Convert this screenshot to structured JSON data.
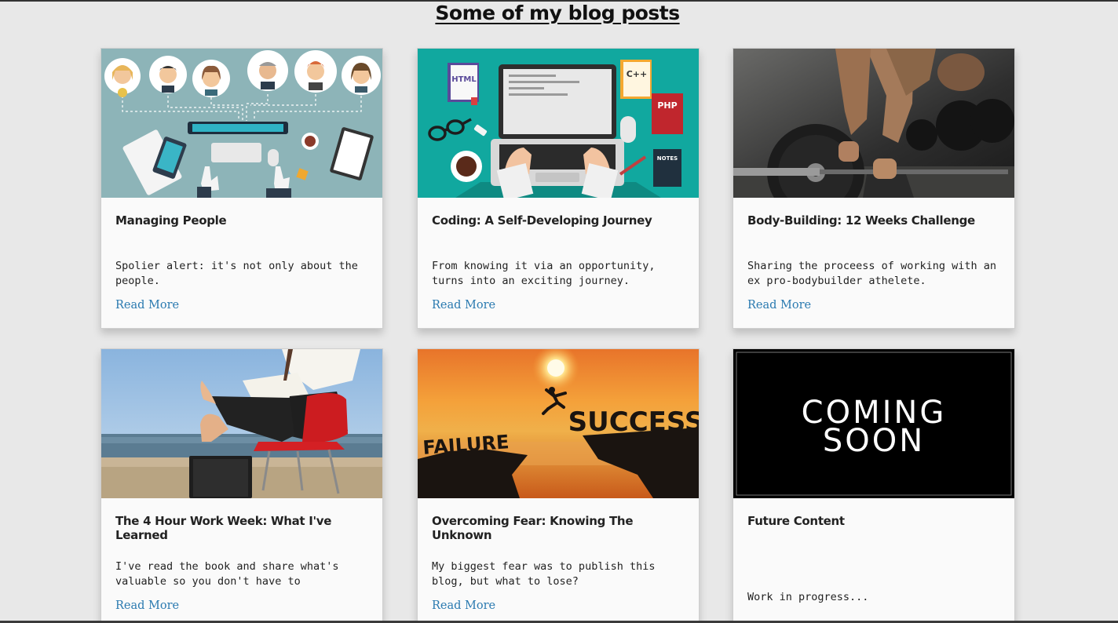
{
  "heading": "Some of my blog posts",
  "colors": {
    "link": "#2a7ab0",
    "card_bg": "#fafafa",
    "page_bg": "#e8e8e8"
  },
  "posts": [
    {
      "title": "Managing People",
      "excerpt": "Spolier alert: it's not only about the people.",
      "link": "Read More",
      "image": "team-management-illustration"
    },
    {
      "title": "Coding: A Self-Developing Journey",
      "excerpt": "From knowing it via an opportunity, turns into an exciting journey.",
      "link": "Read More",
      "image": "laptop-coding-illustration"
    },
    {
      "title": "Body-Building: 12 Weeks Challenge",
      "excerpt": "Sharing the proceess of working with an ex pro-bodybuilder athelete.",
      "link": "Read More",
      "image": "barbell-deadlift-photo"
    },
    {
      "title": "The 4 Hour Work Week: What I've Learned",
      "excerpt": "I've read the book and share what's valuable so you don't have to",
      "link": "Read More",
      "image": "beach-chair-laptop-photo"
    },
    {
      "title": "Overcoming Fear: Knowing The Unknown",
      "excerpt": "My biggest fear was to publish this blog, but what to lose?",
      "link": "Read More",
      "image": "failure-success-cliff-photo"
    },
    {
      "title": "Future Content",
      "excerpt": "Work in progress...",
      "image": "coming-soon-banner",
      "image_text_1": "COMING",
      "image_text_2": "SOON"
    }
  ],
  "images": {
    "coding": {
      "html": "HTML",
      "cpp": "C++",
      "php": "PHP",
      "notes": "NOTES"
    },
    "fear": {
      "failure": "FAILURE",
      "success": "SUCCESS"
    }
  }
}
